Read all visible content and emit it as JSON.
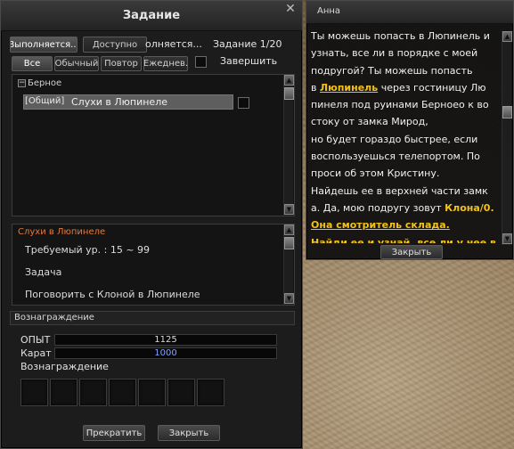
{
  "quest_window": {
    "title": "Задание",
    "tabs_top": [
      {
        "label": "Выполняется..."
      },
      {
        "label": "Доступно"
      }
    ],
    "status_text": "олняется...",
    "quest_count": "Задание 1/20",
    "filter_tabs": [
      {
        "label": "Все"
      },
      {
        "label": "Обычный"
      },
      {
        "label": "Повтор"
      },
      {
        "label": "Ежеднев."
      }
    ],
    "completed_label": "Завершить",
    "region_name": "Берное",
    "quest_item": {
      "tag": "[Общий]",
      "name": "Слухи в Люпинеле"
    },
    "details": {
      "title": "Слухи в Люпинеле",
      "required_level": "Требуемый ур. : 15 ~ 99",
      "task_header": "Задача",
      "task_text": "Поговорить с Клоной в Люпинеле"
    },
    "reward": {
      "header": "Вознаграждение",
      "exp_label": "ОПЫТ",
      "exp_value": "1125",
      "karat_label": "Карат",
      "karat_value": "1000",
      "items_label": "Вознаграждение"
    },
    "buttons": {
      "abandon": "Прекратить",
      "close": "Закрыть"
    }
  },
  "npc_dialog": {
    "name": "Анна",
    "lines": [
      "Ты можешь попасть в Люпинель и",
      "узнать, все ли в порядке с моей",
      "подругой? Ты можешь попасть",
      {
        "pre": "в ",
        "hl": "Люпинель",
        "post": " через гостиницу Лю"
      },
      "пинеля под руинами Берноео к во",
      "стоку от замка Мирод,",
      "но будет гораздо быстрее, если",
      "воспользуешься телепортом. По",
      "проси об этом  Кристину.",
      "Найдешь ее в верхней части замк",
      {
        "pre": "а. Да, мою подругу зовут ",
        "hl": "Клона/0."
      },
      "Она смотритель склада.",
      "Найди ее и узнай. все ли у нее в"
    ],
    "close_button": "Закрыть"
  },
  "colors": {
    "highlight": "#f2c11a",
    "details_title": "#e07a3c",
    "karat_value": "#7fa3ff"
  }
}
